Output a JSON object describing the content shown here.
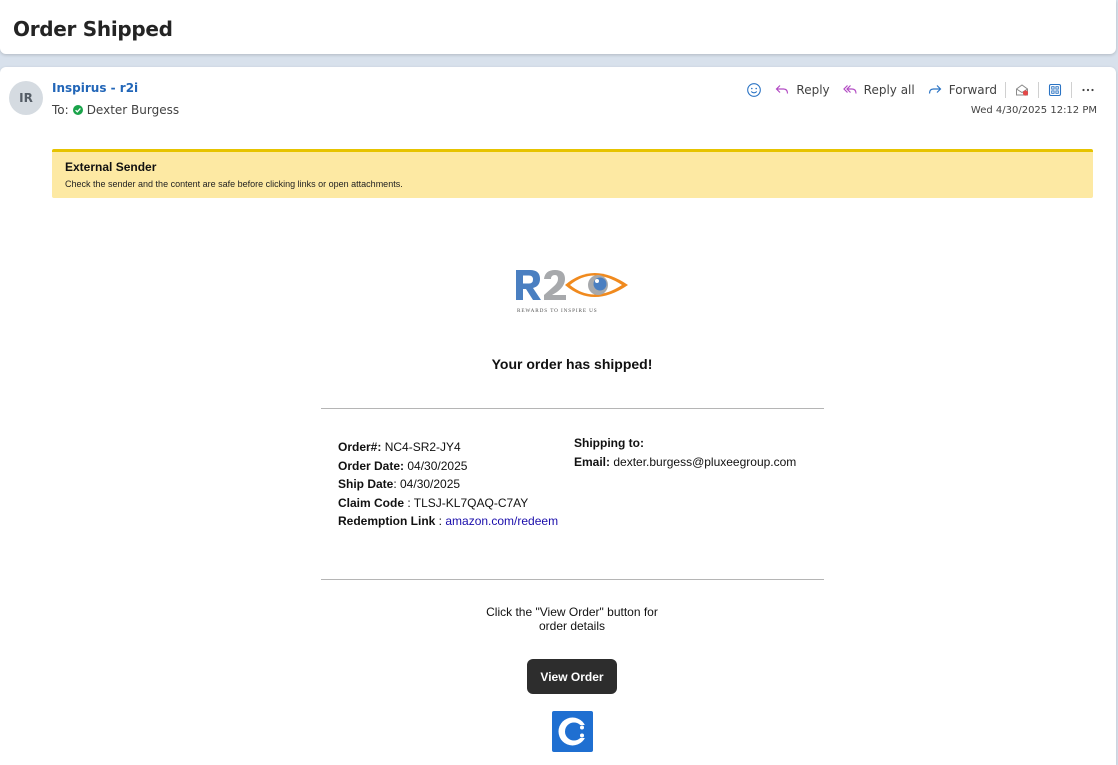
{
  "subject": "Order Shipped",
  "message": {
    "avatar_initials": "IR",
    "sender": "Inspirus - r2i",
    "to_label": "To:",
    "recipient": "Dexter Burgess",
    "timestamp": "Wed 4/30/2025 12:12 PM"
  },
  "toolbar": {
    "reply": "Reply",
    "reply_all": "Reply all",
    "forward": "Forward"
  },
  "banner": {
    "title": "External Sender",
    "text": "Check the sender and the content are safe before clicking links or open attachments."
  },
  "logo": {
    "tagline": "REWARDS TO INSPIRE US"
  },
  "body": {
    "headline": "Your order has shipped!",
    "order_label": "Order#:",
    "order_value": " NC4-SR2-JY4",
    "order_date_label": "Order Date:",
    "order_date_value": " 04/30/2025",
    "ship_date_label": "Ship Date",
    "ship_date_value": ": 04/30/2025",
    "claim_label": "Claim Code",
    "claim_value": " : TLSJ-KL7QAQ-C7AY",
    "redemption_label": "Redemption Link",
    "redemption_sep": " : ",
    "redemption_link": "amazon.com/redeem",
    "shipping_label": "Shipping to:",
    "email_label": "Email:",
    "email_value": " dexter.burgess@pluxeegroup.com",
    "instruction": "Click the \"View Order\" button for order details",
    "view_order": "View Order"
  },
  "colors": {
    "sender_link": "#2266b8",
    "banner_bg": "#fde9a3",
    "banner_border": "#e6c300",
    "button_bg": "#2d2d2d",
    "logo_blue": "#4a7fc1",
    "logo_gray": "#a7a9ac",
    "logo_orange": "#f08a1e"
  }
}
